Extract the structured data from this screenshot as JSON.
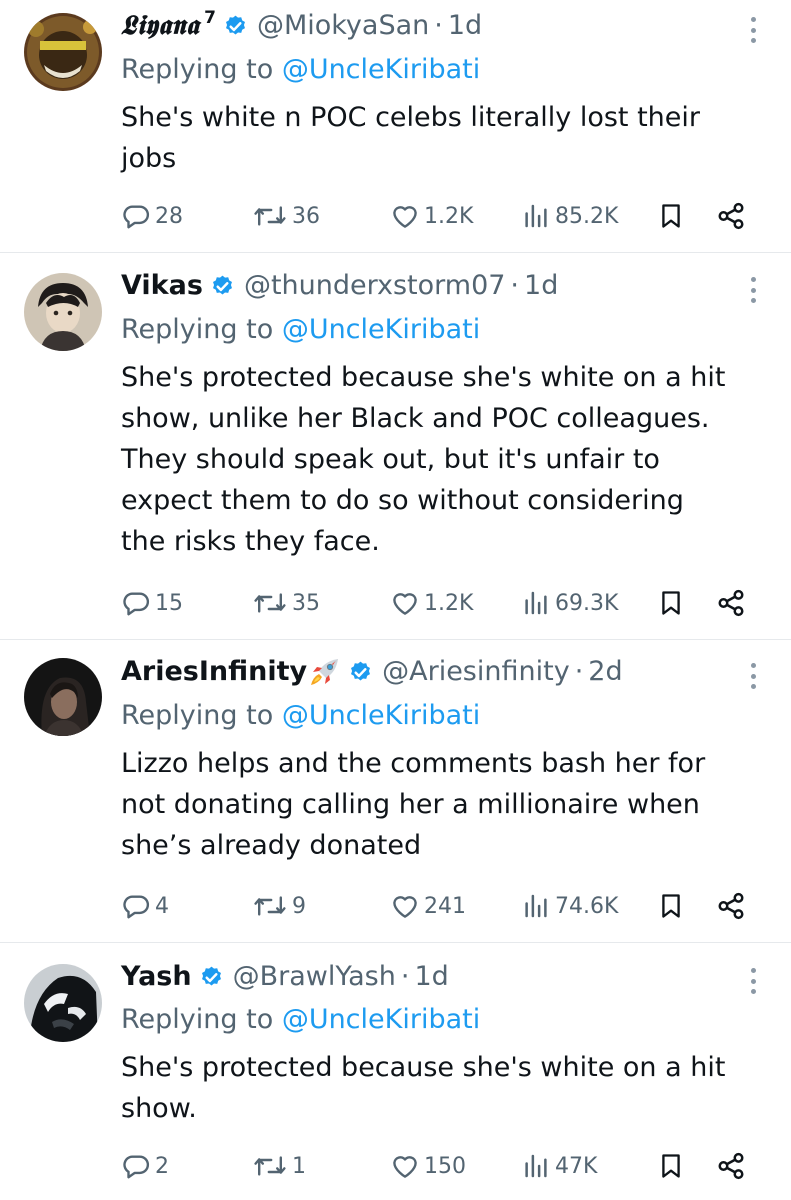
{
  "replying_label": "Replying to",
  "separator": "·",
  "accent_color": "#1d9bf0",
  "secondary_color": "#536471",
  "tweets": [
    {
      "display_name": "𝕷𝖎𝖞𝖆𝖓𝖆",
      "name_suffix": "7",
      "verified": true,
      "handle": "@MiokyaSan",
      "time": "1d",
      "reply_to": "@UncleKiribati",
      "text_lines": [
        "She's white n POC celebs literally lost their",
        "jobs"
      ],
      "replies": "28",
      "retweets": "36",
      "likes": "1.2K",
      "views": "85.2K"
    },
    {
      "display_name": "Vikas",
      "verified": true,
      "handle": "@thunderxstorm07",
      "time": "1d",
      "reply_to": "@UncleKiribati",
      "text_lines": [
        "She's protected because she's white on a hit",
        "show, unlike her Black and POC colleagues.",
        "They should speak out, but it's unfair to",
        "expect them to do so without considering",
        "the risks they face."
      ],
      "replies": "15",
      "retweets": "35",
      "likes": "1.2K",
      "views": "69.3K"
    },
    {
      "display_name": "AriesInfinity",
      "name_emoji": "rocket-emoji",
      "verified": true,
      "handle": "@Ariesinfinity",
      "time": "2d",
      "reply_to": "@UncleKiribati",
      "text_lines": [
        "Lizzo helps and the comments bash her for",
        "not donating calling her a millionaire when",
        "she’s already donated"
      ],
      "replies": "4",
      "retweets": "9",
      "likes": "241",
      "views": "74.6K"
    },
    {
      "display_name": "Yash",
      "verified": true,
      "handle": "@BrawlYash",
      "time": "1d",
      "reply_to": "@UncleKiribati",
      "text_lines": [
        "She's protected because she's white on a hit",
        "show."
      ],
      "replies": "2",
      "retweets": "1",
      "likes": "150",
      "views": "47K"
    }
  ]
}
